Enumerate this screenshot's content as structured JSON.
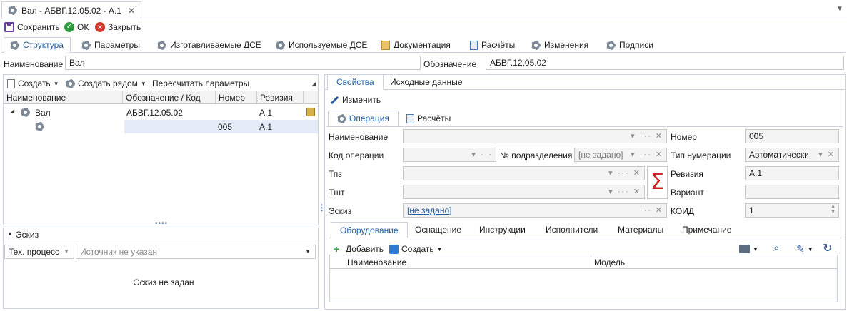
{
  "window": {
    "tab_title": "Вал - АБВГ.12.05.02 - А.1"
  },
  "toolbar": {
    "save": "Сохранить",
    "ok": "ОК",
    "close": "Закрыть"
  },
  "main_tabs": [
    "Структура",
    "Параметры",
    "Изготавливаемые ДСЕ",
    "Используемые ДСЕ",
    "Документация",
    "Расчёты",
    "Изменения",
    "Подписи"
  ],
  "header": {
    "name_label": "Наименование",
    "name_value": "Вал",
    "designation_label": "Обозначение",
    "designation_value": "АБВГ.12.05.02"
  },
  "left_toolbar": {
    "create": "Создать",
    "create_near": "Создать рядом",
    "recalc": "Пересчитать параметры"
  },
  "tree": {
    "columns": [
      "Наименование",
      "Обозначение / Код",
      "Номер",
      "Ревизия"
    ],
    "rows": [
      {
        "name": "Вал",
        "code": "АБВГ.12.05.02",
        "number": "",
        "revision": "А.1"
      },
      {
        "name": "",
        "code": "",
        "number": "005",
        "revision": "А.1"
      }
    ]
  },
  "sketch_panel": {
    "title": "Эскиз",
    "type": "Тех. процесс",
    "source_placeholder": "Источник не указан",
    "empty": "Эскиз не задан"
  },
  "right_tabs": {
    "properties": "Свойства",
    "source_data": "Исходные данные"
  },
  "edit_button": "Изменить",
  "sub_tabs": {
    "operation": "Операция",
    "calc": "Расчёты"
  },
  "form": {
    "name": "Наименование",
    "op_code": "Код операции",
    "subdivision": "№ подразделения",
    "subdivision_value": "[не задано]",
    "tpz": "Тпз",
    "tsht": "Тшт",
    "sketch": "Эскиз",
    "sketch_value": "[не задано]",
    "number": "Номер",
    "number_value": "005",
    "numbering": "Тип нумерации",
    "numbering_value": "Автоматически",
    "revision": "Ревизия",
    "revision_value": "А.1",
    "variant": "Вариант",
    "variant_value": "",
    "koid": "КОИД",
    "koid_value": "1"
  },
  "bottom_tabs": [
    "Оборудование",
    "Оснащение",
    "Инструкции",
    "Исполнители",
    "Материалы",
    "Примечание"
  ],
  "bottom_toolbar": {
    "add": "Добавить",
    "create": "Создать"
  },
  "equip_columns": [
    "Наименование",
    "Модель"
  ],
  "colors": {
    "accent": "#1e5fa8",
    "sigma": "#d21f1f",
    "border": "#c9d2dd"
  }
}
